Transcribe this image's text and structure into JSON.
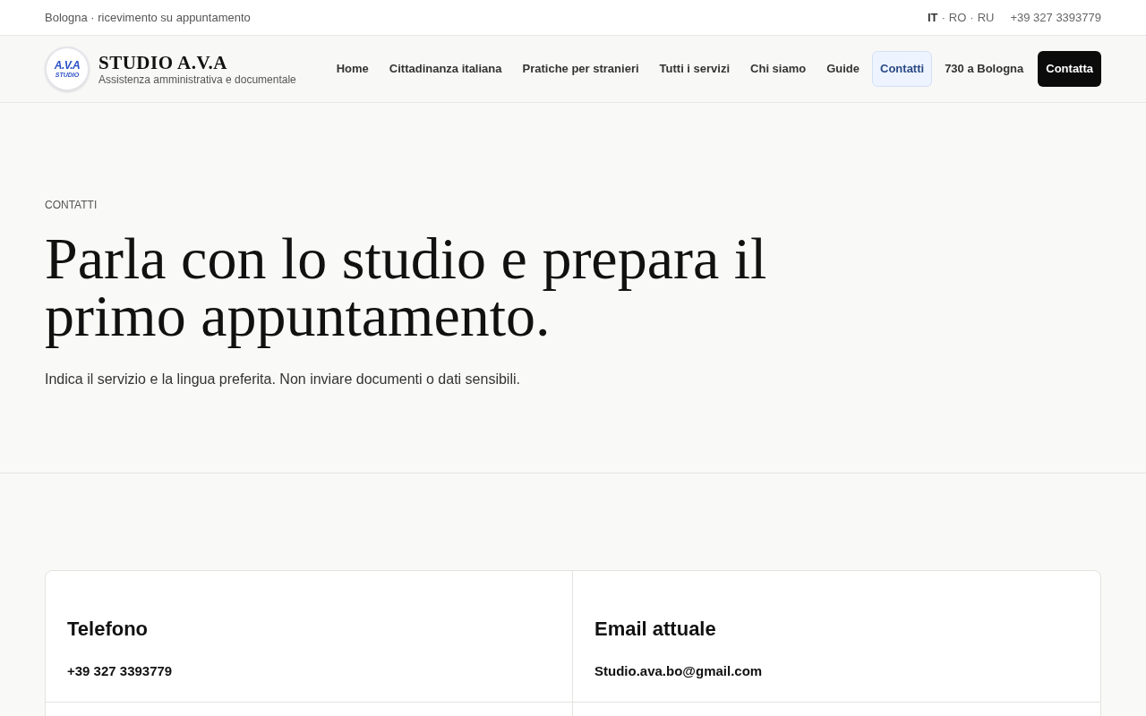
{
  "top_bar": {
    "location": "Bologna · ricevimento su appuntamento",
    "language_separator": "·",
    "languages": [
      {
        "label": "IT",
        "selected": true
      },
      {
        "label": "RO",
        "selected": false
      },
      {
        "label": "RU",
        "selected": false
      }
    ],
    "phone": "+39 327 3393779"
  },
  "header": {
    "logo": {
      "initials": "A.V.A",
      "word": "STUDIO"
    },
    "brand": "STUDIO A.V.A",
    "tagline": "Assistenza amministrativa e documentale",
    "nav": [
      {
        "label": "Home",
        "selected": false
      },
      {
        "label": "Cittadinanza italiana",
        "selected": false
      },
      {
        "label": "Pratiche per stranieri",
        "selected": false
      },
      {
        "label": "Tutti i servizi",
        "selected": false
      },
      {
        "label": "Chi siamo",
        "selected": false
      },
      {
        "label": "Guide",
        "selected": false
      },
      {
        "label": "Contatti",
        "selected": true
      },
      {
        "label": "730 a Bologna",
        "selected": false
      }
    ],
    "cta": "Contatta"
  },
  "hero": {
    "eyebrow": "CONTATTI",
    "title": "Parla con lo studio e prepara il primo appuntamento.",
    "lead": "Indica il servizio e la lingua preferita. Non inviare documenti o dati sensibili."
  },
  "contact_cards": [
    {
      "title": "Telefono",
      "value": "+39 327 3393779"
    },
    {
      "title": "Email attuale",
      "value": "Studio.ava.bo@gmail.com"
    }
  ]
}
